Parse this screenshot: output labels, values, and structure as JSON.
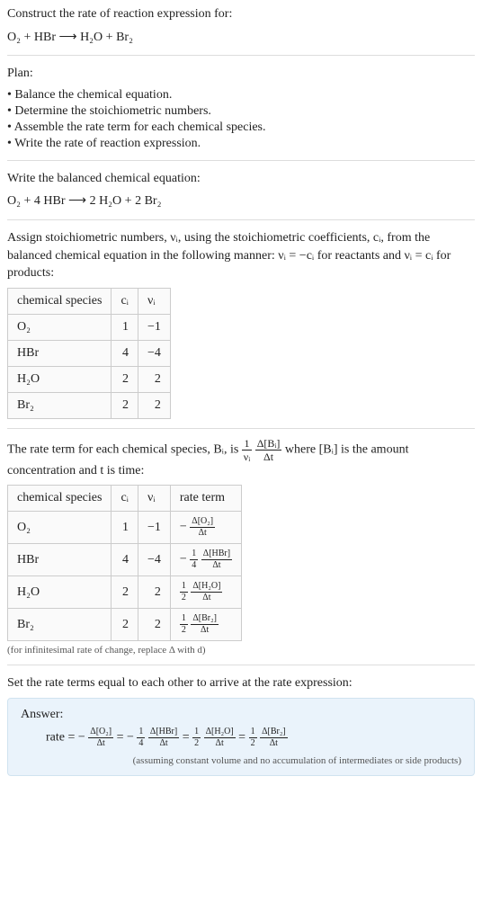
{
  "header": {
    "title": "Construct the rate of reaction expression for:",
    "equation": "O₂ + HBr  ⟶  H₂O + Br₂"
  },
  "plan": {
    "heading": "Plan:",
    "items": [
      "• Balance the chemical equation.",
      "• Determine the stoichiometric numbers.",
      "• Assemble the rate term for each chemical species.",
      "• Write the rate of reaction expression."
    ]
  },
  "balanced": {
    "heading": "Write the balanced chemical equation:",
    "equation": "O₂ + 4 HBr  ⟶  2 H₂O + 2 Br₂"
  },
  "stoich": {
    "text": "Assign stoichiometric numbers, νᵢ, using the stoichiometric coefficients, cᵢ, from the balanced chemical equation in the following manner: νᵢ = −cᵢ for reactants and νᵢ = cᵢ for products:",
    "headers": [
      "chemical species",
      "cᵢ",
      "νᵢ"
    ],
    "rows": [
      {
        "species": "O₂",
        "c": "1",
        "v": "−1"
      },
      {
        "species": "HBr",
        "c": "4",
        "v": "−4"
      },
      {
        "species": "H₂O",
        "c": "2",
        "v": "2"
      },
      {
        "species": "Br₂",
        "c": "2",
        "v": "2"
      }
    ]
  },
  "rateterm": {
    "pre": "The rate term for each chemical species, Bᵢ, is ",
    "mid": " where [Bᵢ] is the amount concentration and t is time:",
    "frac1_num": "1",
    "frac1_den": "νᵢ",
    "frac2_num": "Δ[Bᵢ]",
    "frac2_den": "Δt",
    "headers": [
      "chemical species",
      "cᵢ",
      "νᵢ",
      "rate term"
    ],
    "rows": [
      {
        "species": "O₂",
        "c": "1",
        "v": "−1",
        "sign": "−",
        "coef_num": "",
        "coef_den": "",
        "d_num": "Δ[O₂]",
        "d_den": "Δt"
      },
      {
        "species": "HBr",
        "c": "4",
        "v": "−4",
        "sign": "−",
        "coef_num": "1",
        "coef_den": "4",
        "d_num": "Δ[HBr]",
        "d_den": "Δt"
      },
      {
        "species": "H₂O",
        "c": "2",
        "v": "2",
        "sign": "",
        "coef_num": "1",
        "coef_den": "2",
        "d_num": "Δ[H₂O]",
        "d_den": "Δt"
      },
      {
        "species": "Br₂",
        "c": "2",
        "v": "2",
        "sign": "",
        "coef_num": "1",
        "coef_den": "2",
        "d_num": "Δ[Br₂]",
        "d_den": "Δt"
      }
    ],
    "note": "(for infinitesimal rate of change, replace Δ with d)"
  },
  "final": {
    "heading": "Set the rate terms equal to each other to arrive at the rate expression:"
  },
  "answer": {
    "label": "Answer:",
    "lead": "rate = ",
    "terms": [
      {
        "sign": "−",
        "coef_num": "",
        "coef_den": "",
        "d_num": "Δ[O₂]",
        "d_den": "Δt"
      },
      {
        "sign": "−",
        "coef_num": "1",
        "coef_den": "4",
        "d_num": "Δ[HBr]",
        "d_den": "Δt"
      },
      {
        "sign": "",
        "coef_num": "1",
        "coef_den": "2",
        "d_num": "Δ[H₂O]",
        "d_den": "Δt"
      },
      {
        "sign": "",
        "coef_num": "1",
        "coef_den": "2",
        "d_num": "Δ[Br₂]",
        "d_den": "Δt"
      }
    ],
    "eq": " = ",
    "note": "(assuming constant volume and no accumulation of intermediates or side products)"
  },
  "chart_data": {
    "type": "table",
    "tables": [
      {
        "title": "Stoichiometric numbers",
        "columns": [
          "chemical species",
          "c_i",
          "ν_i"
        ],
        "rows": [
          [
            "O2",
            1,
            -1
          ],
          [
            "HBr",
            4,
            -4
          ],
          [
            "H2O",
            2,
            2
          ],
          [
            "Br2",
            2,
            2
          ]
        ]
      },
      {
        "title": "Rate terms",
        "columns": [
          "chemical species",
          "c_i",
          "ν_i",
          "rate term"
        ],
        "rows": [
          [
            "O2",
            1,
            -1,
            "-(Δ[O2]/Δt)"
          ],
          [
            "HBr",
            4,
            -4,
            "-(1/4)(Δ[HBr]/Δt)"
          ],
          [
            "H2O",
            2,
            2,
            "(1/2)(Δ[H2O]/Δt)"
          ],
          [
            "Br2",
            2,
            2,
            "(1/2)(Δ[Br2]/Δt)"
          ]
        ]
      }
    ],
    "rate_expression": "rate = -(Δ[O2]/Δt) = -(1/4)(Δ[HBr]/Δt) = (1/2)(Δ[H2O]/Δt) = (1/2)(Δ[Br2]/Δt)"
  }
}
